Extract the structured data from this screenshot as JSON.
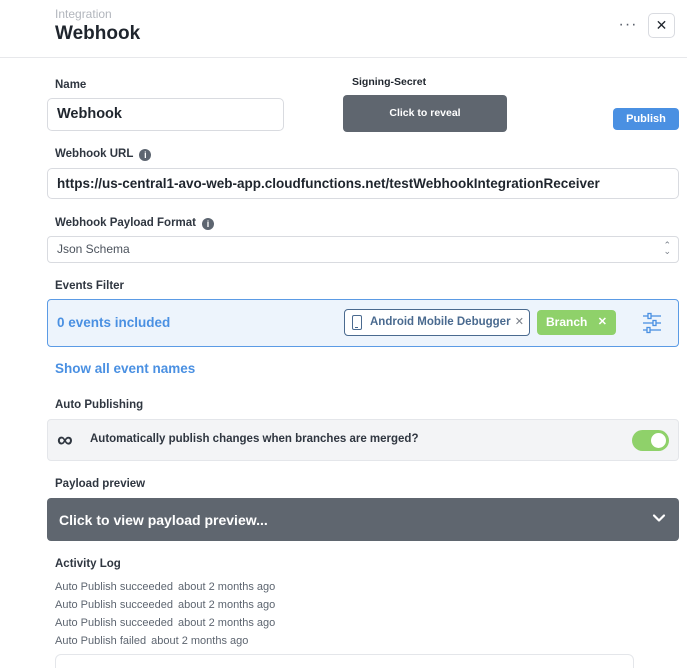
{
  "header": {
    "kicker": "Integration",
    "title": "Webhook",
    "more_icon": "ellipsis-icon",
    "more_glyph": "···",
    "close_icon": "close-icon",
    "close_glyph": "✕"
  },
  "name": {
    "label": "Name",
    "value": "Webhook"
  },
  "signing_secret": {
    "label": "Signing-Secret",
    "button_label": "Click to reveal"
  },
  "publish_button": "Publish",
  "webhook_url": {
    "label": "Webhook URL",
    "info_glyph": "i",
    "value": "https://us-central1-avo-web-app.cloudfunctions.net/testWebhookIntegrationReceiver"
  },
  "payload_format": {
    "label": "Webhook Payload Format",
    "info_glyph": "i",
    "selected": "Json Schema",
    "arrows_up": "⌃",
    "arrows_down": "⌄"
  },
  "events_filter": {
    "label": "Events Filter",
    "count_text": "0 events included",
    "source_chip": "Android Mobile Debugger",
    "branch_chip": "Branch",
    "remove_glyph": "✕",
    "filter_icon": "filter-sliders-icon"
  },
  "show_all_link": "Show all event names",
  "auto_publishing": {
    "label": "Auto Publishing",
    "icon": "infinity-icon",
    "icon_glyph": "∞",
    "text": "Automatically publish changes when branches are merged?",
    "enabled": true,
    "toggle_color": "#8fd16a"
  },
  "payload_preview": {
    "label": "Payload preview",
    "bar_text": "Click to view payload preview...",
    "chevron": "chevron-down-icon"
  },
  "activity_log": {
    "label": "Activity Log",
    "entries": [
      {
        "action": "Auto Publish succeeded",
        "time": "about 2 months ago"
      },
      {
        "action": "Auto Publish succeeded",
        "time": "about 2 months ago"
      },
      {
        "action": "Auto Publish succeeded",
        "time": "about 2 months ago"
      },
      {
        "action": "Auto Publish failed",
        "time": "about 2 months ago"
      }
    ]
  },
  "colors": {
    "accent": "#4a90e2",
    "dark_button": "#5f666f",
    "branch_green": "#8fd16a"
  }
}
